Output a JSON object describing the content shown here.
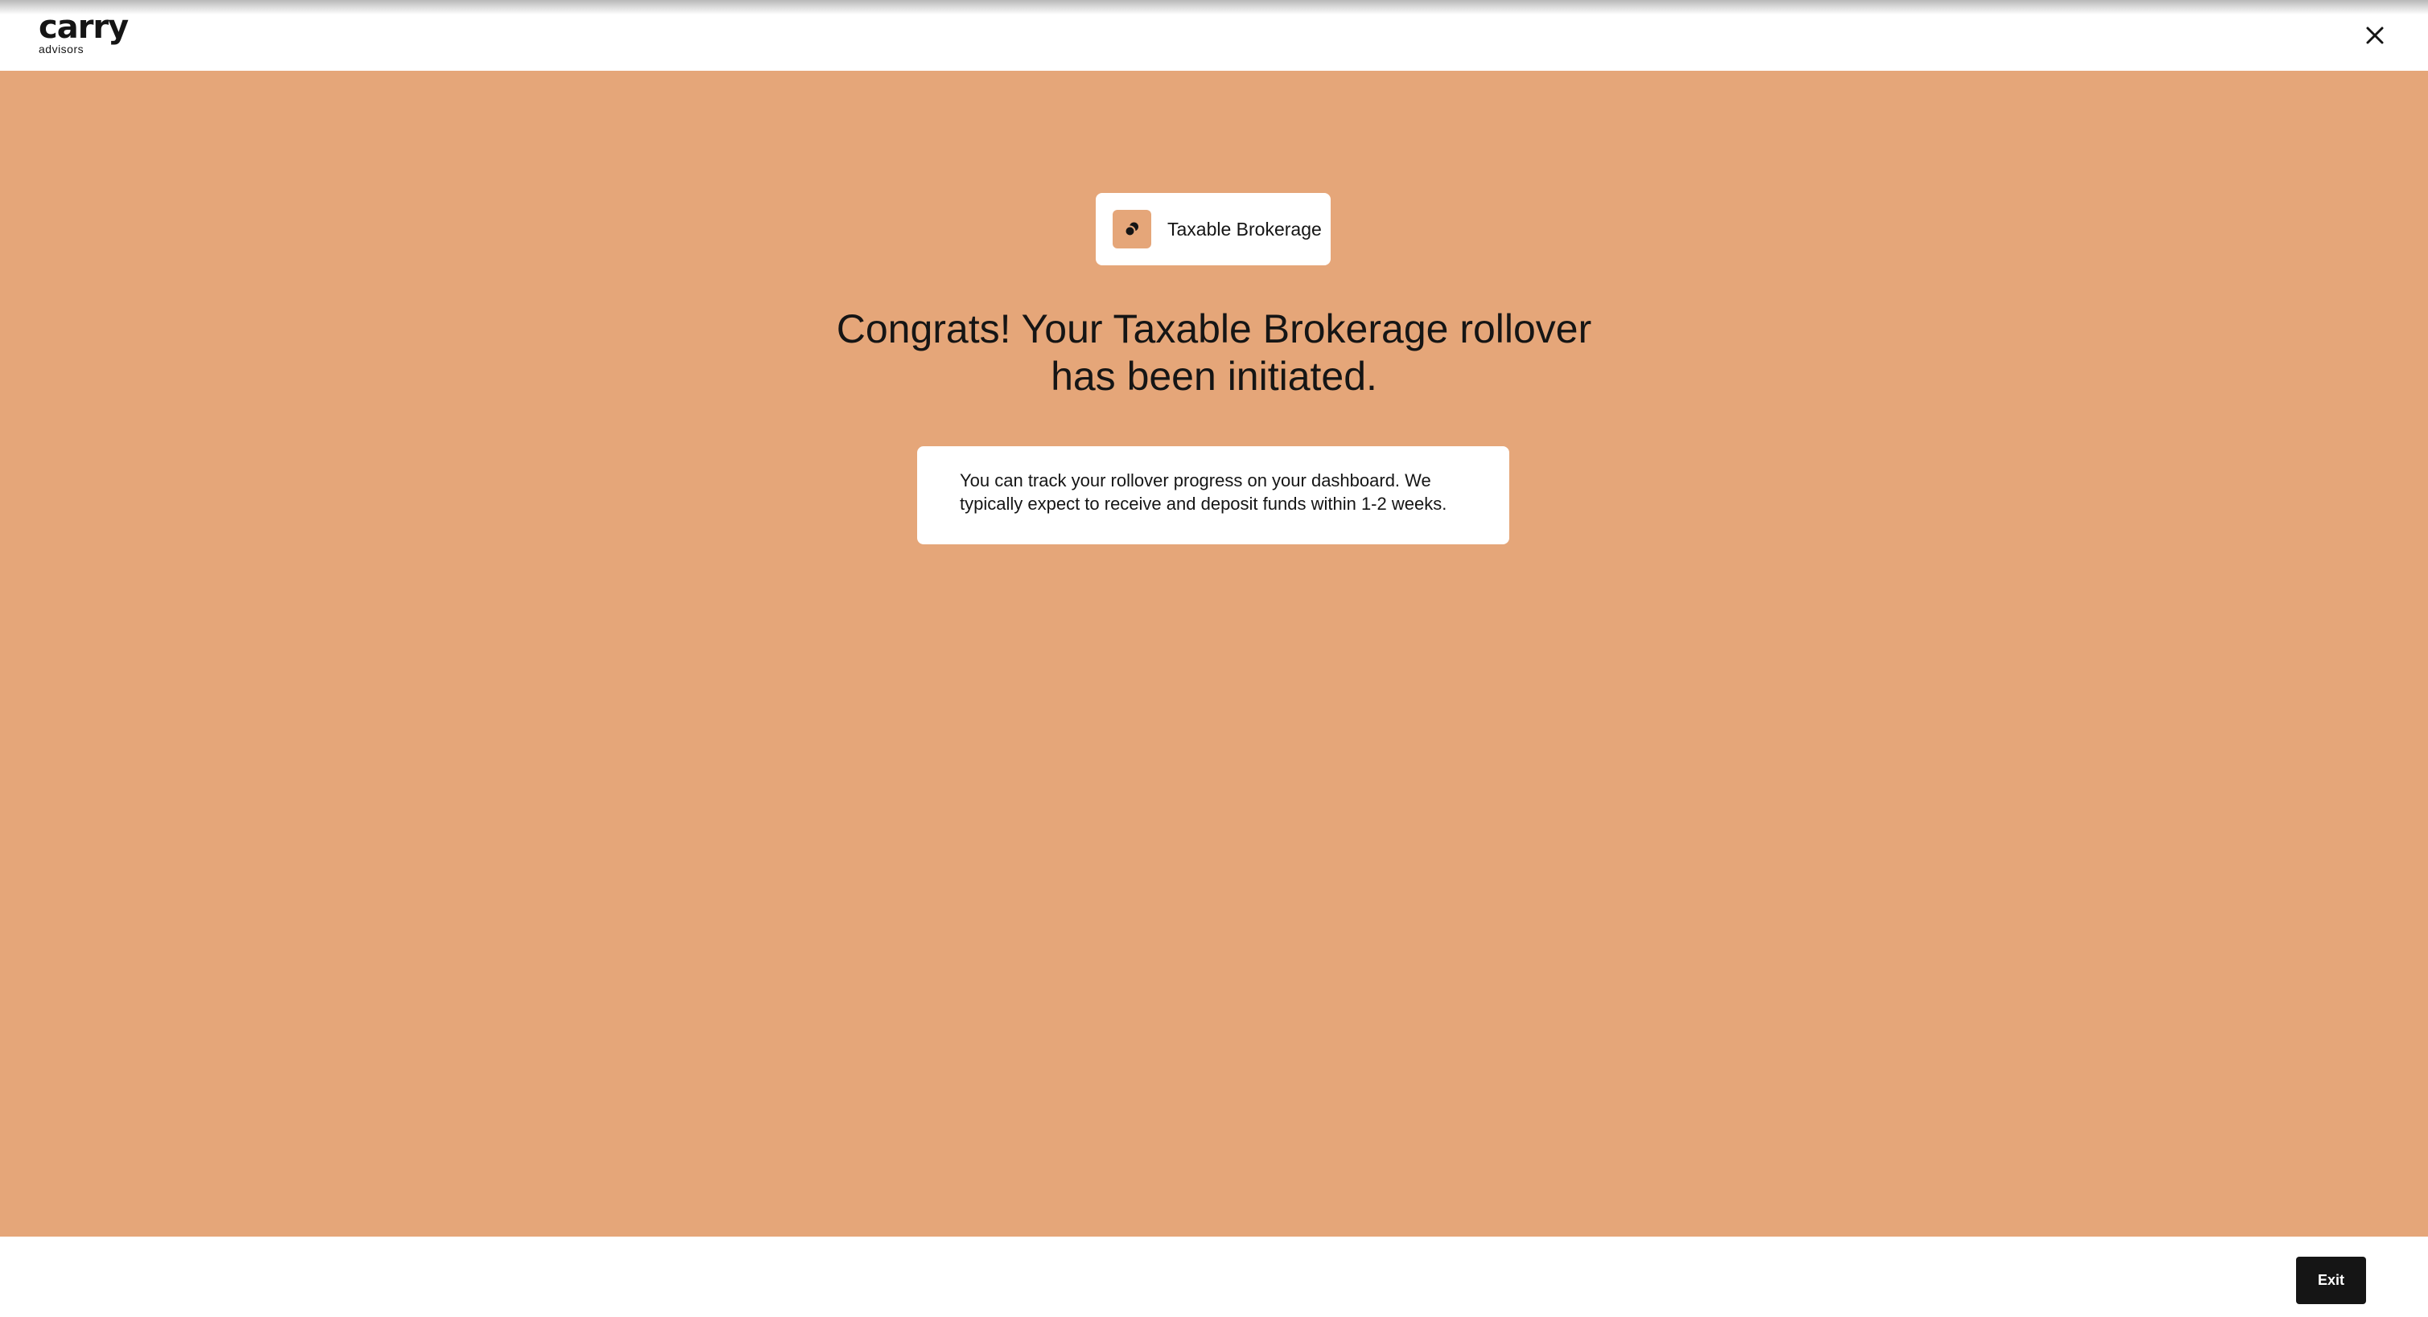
{
  "header": {
    "logo_word": "carry",
    "logo_sub": "advisors",
    "close_icon": "close-icon"
  },
  "account_chip": {
    "icon": "coins-icon",
    "label": "Taxable Brokerage"
  },
  "headline": "Congrats! Your Taxable Brokerage rollover has been initiated.",
  "info_text": "You can track your rollover progress on your dashboard. We typically expect to receive and deposit funds within 1-2 weeks.",
  "footer": {
    "exit_label": "Exit"
  },
  "colors": {
    "accent_background": "#e5a679",
    "text": "#151515",
    "surface": "#ffffff",
    "button": "#151515"
  }
}
